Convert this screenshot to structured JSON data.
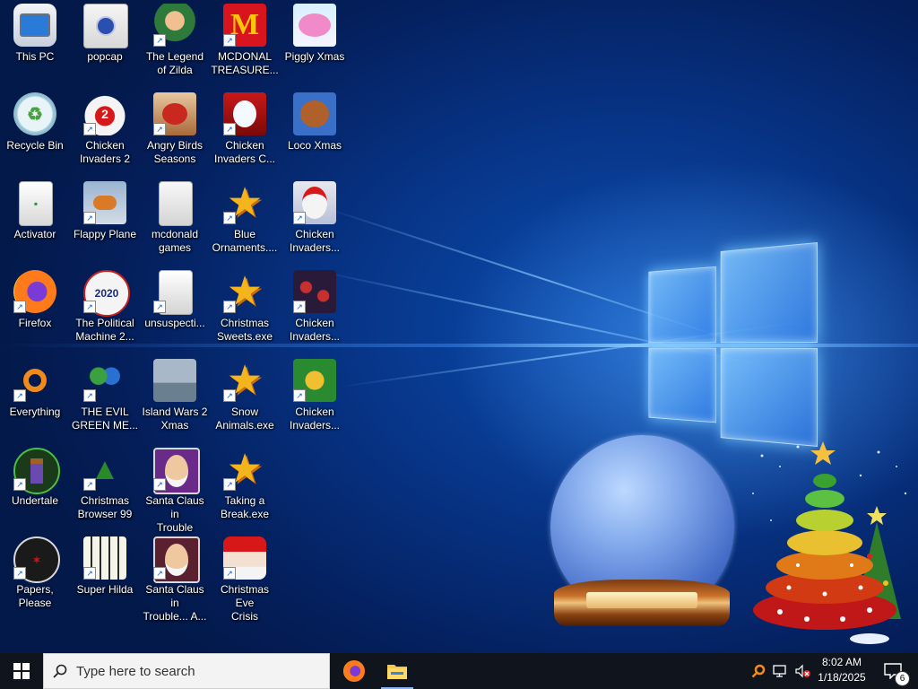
{
  "desktop": {
    "icons": [
      {
        "label": "This PC",
        "icon": "computer-icon",
        "shortcut": false
      },
      {
        "label": "popcap",
        "icon": "folder-icon",
        "shortcut": false
      },
      {
        "label": "The Legend\nof Zilda",
        "icon": "game-icon",
        "shortcut": true
      },
      {
        "label": "MCDONAL\nTREASURE...",
        "icon": "mcdonalds-icon",
        "shortcut": true
      },
      {
        "label": "Piggly Xmas",
        "icon": "pig-icon",
        "shortcut": false
      },
      {
        "label": "Recycle Bin",
        "icon": "recycle-bin-icon",
        "shortcut": false
      },
      {
        "label": "Chicken\nInvaders 2",
        "icon": "chicken-icon",
        "shortcut": true
      },
      {
        "label": "Angry Birds\nSeasons",
        "icon": "angry-birds-icon",
        "shortcut": true
      },
      {
        "label": "Chicken\nInvaders C...",
        "icon": "snowman-icon",
        "shortcut": true
      },
      {
        "label": "Loco Xmas",
        "icon": "teddy-bear-icon",
        "shortcut": false
      },
      {
        "label": "Activator",
        "icon": "file-icon",
        "shortcut": false
      },
      {
        "label": "Flappy Plane",
        "icon": "plane-icon",
        "shortcut": true
      },
      {
        "label": "mcdonald\ngames",
        "icon": "folder-icon",
        "shortcut": false
      },
      {
        "label": "Blue\nOrnaments....",
        "icon": "star-icon",
        "shortcut": true
      },
      {
        "label": "Chicken\nInvaders...",
        "icon": "chicken-santa-icon",
        "shortcut": true
      },
      {
        "label": "Firefox",
        "icon": "firefox-icon",
        "shortcut": true
      },
      {
        "label": "The Political\nMachine 2...",
        "icon": "political-2020-icon",
        "shortcut": true
      },
      {
        "label": "unsuspecti...",
        "icon": "file-icon",
        "shortcut": true
      },
      {
        "label": "Christmas\nSweets.exe",
        "icon": "star-icon",
        "shortcut": true
      },
      {
        "label": "Chicken\nInvaders...",
        "icon": "ornaments-icon",
        "shortcut": true
      },
      {
        "label": "Everything",
        "icon": "search-icon",
        "shortcut": true
      },
      {
        "label": "THE EVIL\nGREEN ME...",
        "icon": "messenger-icon",
        "shortcut": true
      },
      {
        "label": "Island Wars 2\nXmas",
        "icon": "ship-icon",
        "shortcut": false
      },
      {
        "label": "Snow\nAnimals.exe",
        "icon": "star-icon",
        "shortcut": true
      },
      {
        "label": "Chicken\nInvaders...",
        "icon": "chicken-green-icon",
        "shortcut": true
      },
      {
        "label": "Undertale",
        "icon": "undertale-icon",
        "shortcut": true
      },
      {
        "label": "Christmas\nBrowser 99",
        "icon": "christmas-tree-icon",
        "shortcut": true
      },
      {
        "label": "Santa Claus in\nTrouble",
        "icon": "santa-icon",
        "shortcut": true
      },
      {
        "label": "Taking a\nBreak.exe",
        "icon": "star-icon",
        "shortcut": true
      },
      {
        "label": "Papers, Please",
        "icon": "papers-please-icon",
        "shortcut": true
      },
      {
        "label": "Super Hilda",
        "icon": "pixel-cat-icon",
        "shortcut": true
      },
      {
        "label": "Santa Claus in\nTrouble... A...",
        "icon": "santa-icon",
        "shortcut": true
      },
      {
        "label": "Christmas Eve\nCrisis",
        "icon": "santa-face-icon",
        "shortcut": true
      }
    ]
  },
  "taskbar": {
    "search_placeholder": "Type here to search",
    "pinned": [
      {
        "name": "firefox",
        "icon": "firefox-icon"
      },
      {
        "name": "file-explorer",
        "icon": "folder-icon"
      }
    ],
    "tray_icons": [
      "everything-search-icon",
      "network-icon",
      "volume-muted-icon"
    ],
    "clock_time": "8:02 AM",
    "clock_date": "1/18/2025",
    "notification_count": "6"
  },
  "colors": {
    "taskbar_bg": "#10141c",
    "wallpaper_accent": "#0b4fb3",
    "shortcut_arrow": "#1a5fd0"
  }
}
